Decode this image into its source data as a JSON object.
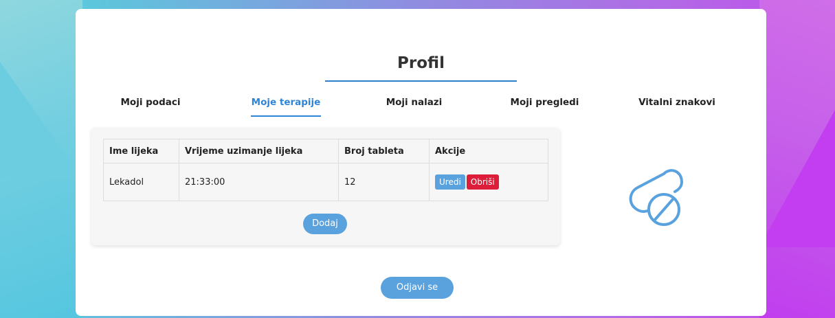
{
  "page": {
    "title": "Profil"
  },
  "tabs": [
    {
      "label": "Moji podaci",
      "active": false
    },
    {
      "label": "Moje terapije",
      "active": true
    },
    {
      "label": "Moji nalazi",
      "active": false
    },
    {
      "label": "Moji pregledi",
      "active": false
    },
    {
      "label": "Vitalni znakovi",
      "active": false
    }
  ],
  "therapy_table": {
    "headers": [
      "Ime lijeka",
      "Vrijeme uzimanje lijeka",
      "Broj tableta",
      "Akcije"
    ],
    "rows": [
      {
        "name": "Lekadol",
        "time": "21:33:00",
        "count": "12"
      }
    ],
    "edit_label": "Uredi",
    "delete_label": "Obriši",
    "add_label": "Dodaj"
  },
  "logout_label": "Odjavi se",
  "icons": {
    "illustration": "pills-icon"
  },
  "colors": {
    "accent": "#2e84d5",
    "button": "#5aa2de",
    "danger": "#dc1e3a"
  }
}
